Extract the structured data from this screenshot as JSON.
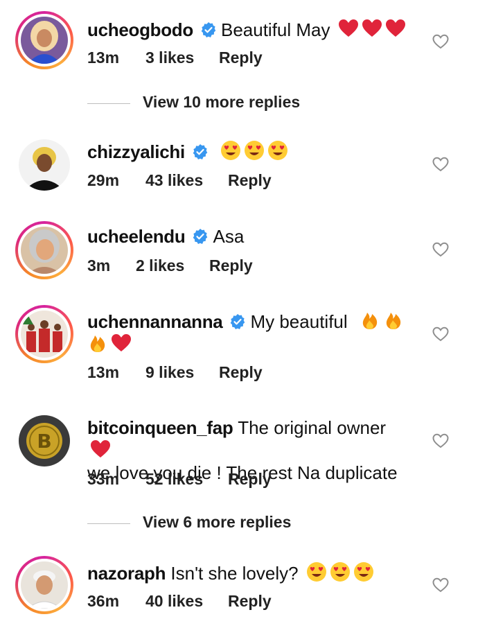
{
  "comments": [
    {
      "username": "ucheogbodo",
      "verified": true,
      "text": "Beautiful May",
      "emojis": [
        "red-heart",
        "red-heart",
        "red-heart"
      ],
      "time": "13m",
      "likes": "3 likes",
      "reply_label": "Reply"
    },
    {
      "username": "chizzyalichi",
      "verified": true,
      "text": "",
      "emojis": [
        "heart-eyes",
        "heart-eyes",
        "heart-eyes"
      ],
      "time": "29m",
      "likes": "43 likes",
      "reply_label": "Reply"
    },
    {
      "username": "ucheelendu",
      "verified": true,
      "text": "Asa",
      "emojis": [],
      "time": "3m",
      "likes": "2 likes",
      "reply_label": "Reply"
    },
    {
      "username": "uchennannanna",
      "verified": true,
      "text": "My beautiful",
      "emojis": [
        "fire",
        "fire",
        "fire",
        "red-heart"
      ],
      "time": "13m",
      "likes": "9 likes",
      "reply_label": "Reply"
    },
    {
      "username": "bitcoinqueen_fap",
      "verified": false,
      "text": "The original owner",
      "text_line2": "we love you die ! The rest Na duplicate",
      "emojis": [
        "red-heart"
      ],
      "time": "33m",
      "likes": "52 likes",
      "reply_label": "Reply"
    },
    {
      "username": "nazoraph",
      "verified": false,
      "text": "Isn't she lovely?",
      "emojis": [
        "heart-eyes",
        "heart-eyes",
        "heart-eyes"
      ],
      "time": "36m",
      "likes": "40 likes",
      "reply_label": "Reply"
    }
  ],
  "view_more_1": "View 10 more replies",
  "view_more_2": "View 6 more replies",
  "colors": {
    "verified_blue": "#3897f0",
    "emoji_red": "#e0243a",
    "emoji_yellow": "#ffcc33",
    "ring_gradient": [
      "#d6249f",
      "#fd5949",
      "#fdae3e"
    ]
  }
}
